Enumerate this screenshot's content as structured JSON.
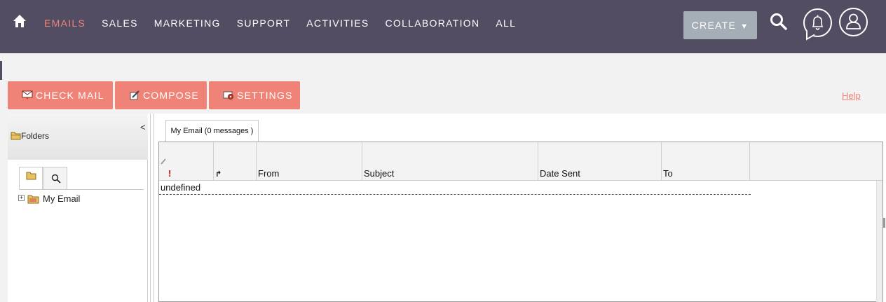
{
  "nav": {
    "items": [
      {
        "label": "EMAILS",
        "active": true
      },
      {
        "label": "SALES"
      },
      {
        "label": "MARKETING"
      },
      {
        "label": "SUPPORT"
      },
      {
        "label": "ACTIVITIES"
      },
      {
        "label": "COLLABORATION"
      },
      {
        "label": "ALL"
      }
    ],
    "create_label": "CREATE",
    "icons": {
      "home": "home-icon",
      "search": "search-icon",
      "notifications": "bell-icon",
      "user": "user-icon"
    }
  },
  "actions": {
    "check_mail": "CHECK MAIL",
    "compose": "COMPOSE",
    "settings": "SETTINGS",
    "help": "Help"
  },
  "folders": {
    "title": "Folders",
    "collapse": "<",
    "tree": [
      {
        "label": "My Email",
        "expander": "+"
      }
    ]
  },
  "email_list": {
    "tab_label": "My Email (0 messages )",
    "columns": [
      "!",
      "↱",
      "From",
      "Subject",
      "Date Sent",
      "To"
    ],
    "rows": [
      {
        "text": "undefined"
      }
    ]
  },
  "colors": {
    "nav_bg": "#534d64",
    "accent": "#f08377",
    "create_bg": "#a5adb6"
  }
}
